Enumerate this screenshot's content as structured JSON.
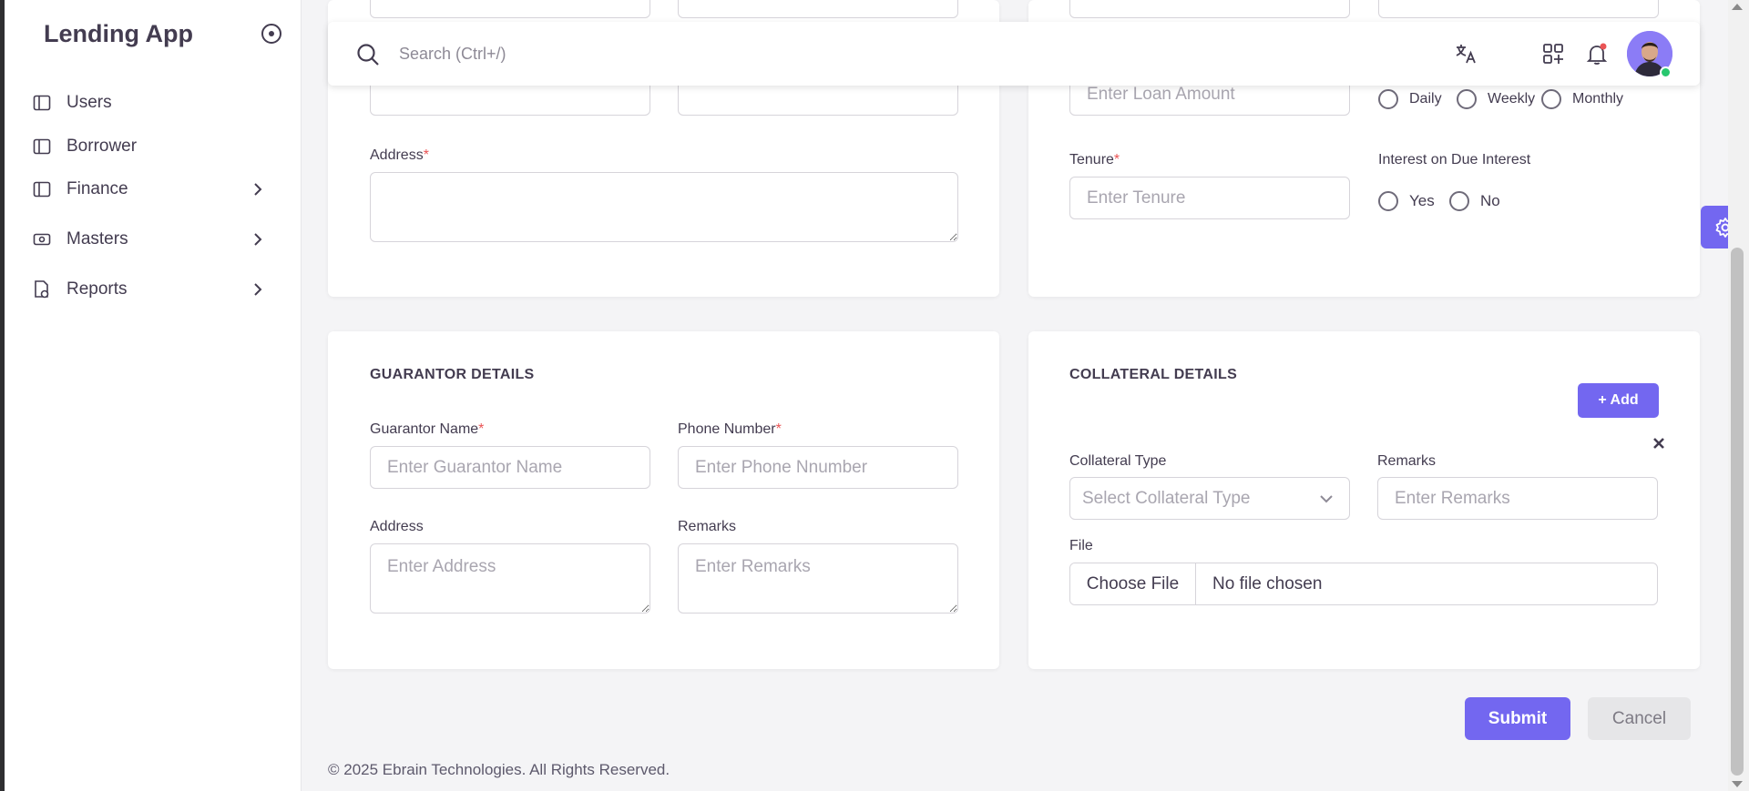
{
  "app": {
    "title": "Lending App"
  },
  "sidebar": {
    "items": [
      {
        "label": "Users",
        "icon": "layout-icon",
        "has_children": false
      },
      {
        "label": "Borrower",
        "icon": "layout-icon",
        "has_children": false
      },
      {
        "label": "Finance",
        "icon": "layout-icon",
        "has_children": true
      },
      {
        "label": "Masters",
        "icon": "money-icon",
        "has_children": true
      },
      {
        "label": "Reports",
        "icon": "report-icon",
        "has_children": true
      }
    ]
  },
  "topbar": {
    "search_placeholder": "Search (Ctrl+/)",
    "icons": [
      "search-icon",
      "translate-icon",
      "shortcuts-icon",
      "notification-bell-icon"
    ],
    "notification_dot_color": "#ea5455",
    "status_color": "#28c76f"
  },
  "borrower_section": {
    "address_label": "Address",
    "address_required_mark": "*"
  },
  "loan_section": {
    "loan_amount_placeholder": "Enter Loan Amount",
    "frequency_options": [
      "Daily",
      "Weekly",
      "Monthly"
    ],
    "tenure_label": "Tenure",
    "tenure_required_mark": "*",
    "tenure_placeholder": "Enter Tenure",
    "interest_due_label": "Interest on Due Interest",
    "interest_due_options": [
      "Yes",
      "No"
    ]
  },
  "guarantor": {
    "title": "GUARANTOR DETAILS",
    "name_label": "Guarantor Name",
    "name_required_mark": "*",
    "name_placeholder": "Enter Guarantor Name",
    "phone_label": "Phone Number",
    "phone_required_mark": "*",
    "phone_placeholder": "Enter Phone Nnumber",
    "address_label": "Address",
    "address_placeholder": "Enter Address",
    "remarks_label": "Remarks",
    "remarks_placeholder": "Enter Remarks"
  },
  "collateral": {
    "title": "COLLATERAL DETAILS",
    "add_label": "+ Add",
    "type_label": "Collateral Type",
    "type_placeholder": "Select Collateral Type",
    "remarks_label": "Remarks",
    "remarks_placeholder": "Enter Remarks",
    "file_label": "File",
    "file_button": "Choose File",
    "file_status": "No file chosen"
  },
  "actions": {
    "submit": "Submit",
    "cancel": "Cancel"
  },
  "footer": {
    "text": "© 2025 Ebrain Technologies. All Rights Reserved."
  },
  "colors": {
    "accent": "#7367f0",
    "required": "#ea5455",
    "text": "#433c50"
  }
}
